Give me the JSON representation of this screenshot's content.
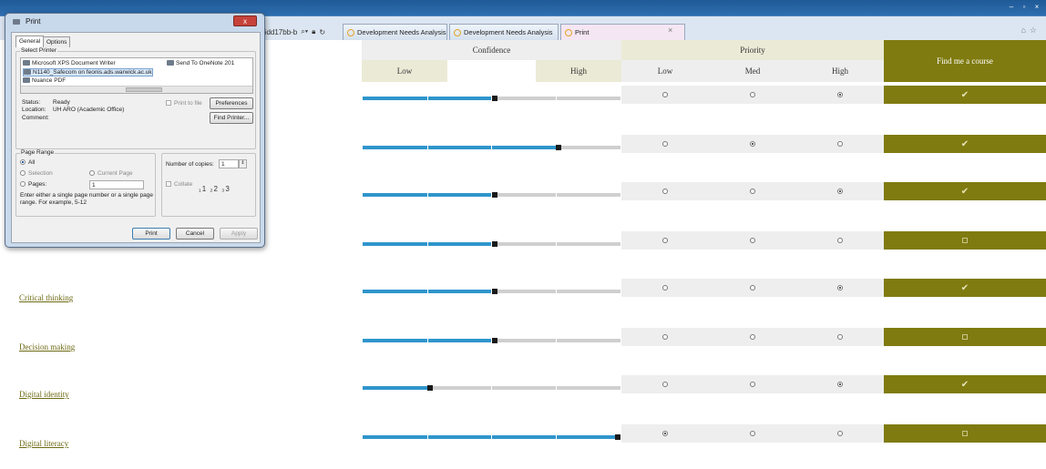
{
  "browser": {
    "address_fragment": "6dd17bb-b",
    "tabs": [
      {
        "label": "Development Needs Analysis"
      },
      {
        "label": "Development Needs Analysis"
      },
      {
        "label": "Print"
      }
    ],
    "tab_close": "×"
  },
  "table": {
    "confidence_label": "Confidence",
    "priority_label": "Priority",
    "find_course_label": "Find me a course",
    "conf_low": "Low",
    "conf_high": "High",
    "pri_low": "Low",
    "pri_med": "Med",
    "pri_high": "High",
    "rows": [
      {
        "skill": "",
        "confidence": 0.5,
        "priority": "High",
        "course": "✔"
      },
      {
        "skill": "",
        "confidence": 0.75,
        "priority": "Med",
        "course": "✔"
      },
      {
        "skill": "",
        "confidence": 0.5,
        "priority": "High",
        "course": "✔"
      },
      {
        "skill": "",
        "confidence": 0.5,
        "priority": "",
        "course": ""
      },
      {
        "skill": "Critical thinking",
        "confidence": 0.5,
        "priority": "High",
        "course": "✔"
      },
      {
        "skill": "Decision making",
        "confidence": 0.5,
        "priority": "",
        "course": ""
      },
      {
        "skill": "Digital identity",
        "confidence": 0.25,
        "priority": "High",
        "course": "✔"
      },
      {
        "skill": "Digital literacy",
        "confidence": 1.0,
        "priority": "Low",
        "course": ""
      }
    ]
  },
  "dialog": {
    "title": "Print",
    "close": "x",
    "tab_general": "General",
    "tab_options": "Options",
    "select_printer": "Select Printer",
    "printers": [
      "Microsoft XPS Document Writer",
      "Send To OneNote 201",
      "N1140_Safecom on feonis.ads.warwick.ac.uk",
      "Nuance PDF"
    ],
    "status_label": "Status:",
    "status_value": "Ready",
    "location_label": "Location:",
    "location_value": "UH ARO (Academic Office)",
    "comment_label": "Comment:",
    "print_to_file": "Print to file",
    "preferences": "Preferences",
    "find_printer": "Find Printer...",
    "page_range": "Page Range",
    "all": "All",
    "selection": "Selection",
    "current_page": "Current Page",
    "pages": "Pages:",
    "pages_value": "1",
    "hint": "Enter either a single page number or a single page range.  For example, 5-12",
    "copies_label": "Number of copies:",
    "copies_value": "1",
    "collate": "Collate",
    "print_btn": "Print",
    "cancel_btn": "Cancel",
    "apply_btn": "Apply"
  }
}
